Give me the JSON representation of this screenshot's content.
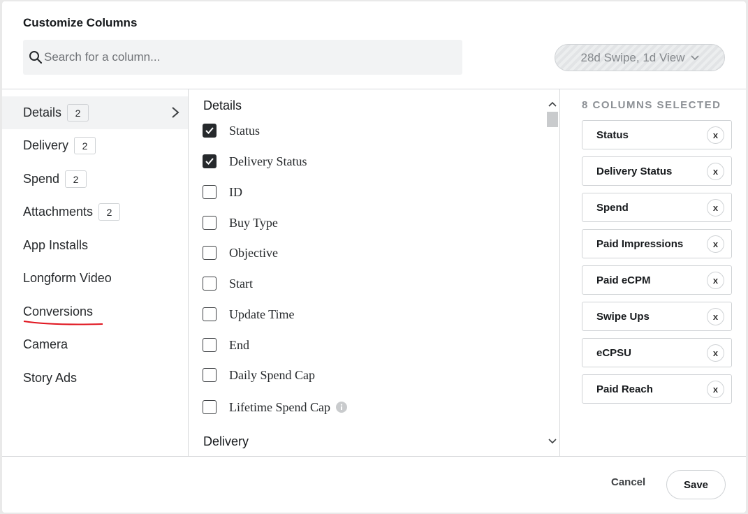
{
  "dialog": {
    "title": "Customize Columns",
    "search_placeholder": "Search for a column...",
    "attribution_label": "28d Swipe, 1d View"
  },
  "categories": [
    {
      "label": "Details",
      "count": "2",
      "active": true
    },
    {
      "label": "Delivery",
      "count": "2"
    },
    {
      "label": "Spend",
      "count": "2"
    },
    {
      "label": "Attachments",
      "count": "2"
    },
    {
      "label": "App Installs"
    },
    {
      "label": "Longform Video"
    },
    {
      "label": "Conversions"
    },
    {
      "label": "Camera"
    },
    {
      "label": "Story Ads"
    }
  ],
  "options": {
    "section_title": "Details",
    "next_section_title": "Delivery",
    "items": [
      {
        "label": "Status",
        "checked": true
      },
      {
        "label": "Delivery Status",
        "checked": true
      },
      {
        "label": "ID",
        "checked": false
      },
      {
        "label": "Buy Type",
        "checked": false
      },
      {
        "label": "Objective",
        "checked": false
      },
      {
        "label": "Start",
        "checked": false
      },
      {
        "label": "Update Time",
        "checked": false
      },
      {
        "label": "End",
        "checked": false
      },
      {
        "label": "Daily Spend Cap",
        "checked": false
      },
      {
        "label": "Lifetime Spend Cap",
        "checked": false,
        "info": true
      }
    ]
  },
  "selected": {
    "header": "8 COLUMNS SELECTED",
    "items": [
      "Status",
      "Delivery Status",
      "Spend",
      "Paid Impressions",
      "Paid eCPM",
      "Swipe Ups",
      "eCPSU",
      "Paid Reach"
    ],
    "remove_glyph": "x"
  },
  "footer": {
    "cancel_label": "Cancel",
    "save_label": "Save"
  },
  "colors": {
    "annotation_underline": "#e0141e",
    "checked_box": "#26292c"
  }
}
